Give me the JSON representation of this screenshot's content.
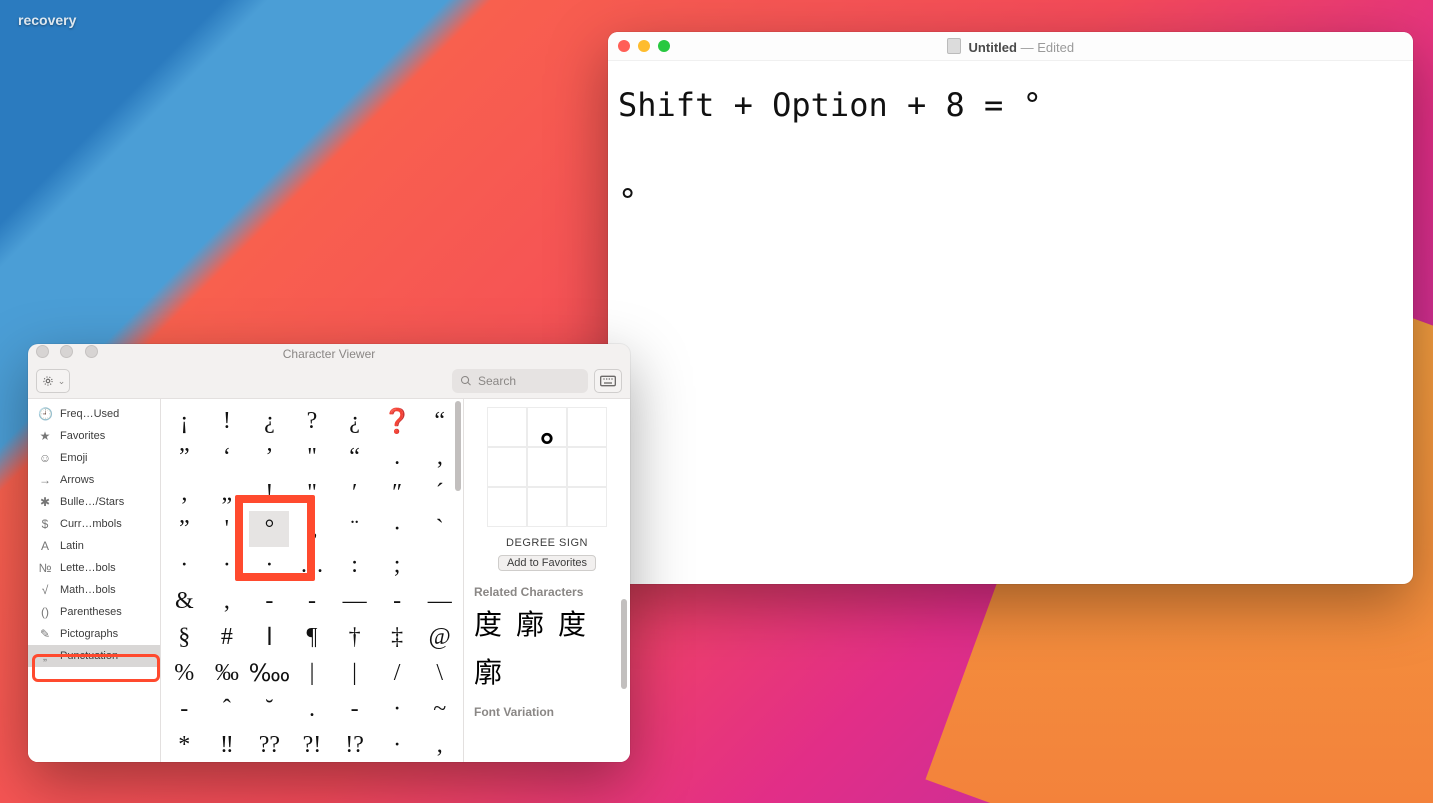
{
  "desktop": {
    "folder_name": "recovery"
  },
  "textedit": {
    "title": "Untitled",
    "status": "Edited",
    "content": "Shift + Option + 8 = °\n\n°"
  },
  "char_viewer": {
    "title": "Character Viewer",
    "search_placeholder": "Search",
    "categories": [
      {
        "icon": "🕘",
        "label": "Freq…Used"
      },
      {
        "icon": "★",
        "label": "Favorites"
      },
      {
        "icon": "☺",
        "label": "Emoji"
      },
      {
        "icon": "→",
        "label": "Arrows"
      },
      {
        "icon": "✱",
        "label": "Bulle…/Stars"
      },
      {
        "icon": "$",
        "label": "Curr…mbols"
      },
      {
        "icon": "A",
        "label": "Latin"
      },
      {
        "icon": "№",
        "label": "Lette…bols"
      },
      {
        "icon": "√",
        "label": "Math…bols"
      },
      {
        "icon": "()",
        "label": "Parentheses"
      },
      {
        "icon": "✎",
        "label": "Pictographs"
      },
      {
        "icon": "„",
        "label": "Punctuation",
        "selected": true
      }
    ],
    "glyph_rows": [
      [
        "¡",
        "!",
        "¿",
        "?",
        "¿",
        "❓",
        "“"
      ],
      [
        "”",
        "‘",
        "’",
        "\"",
        "“",
        " .",
        "‚"
      ],
      [
        "‚",
        "„",
        "!",
        "\"",
        "′",
        "″",
        "´"
      ],
      [
        "”",
        "'",
        "°",
        "„",
        "¨",
        "·",
        "`"
      ],
      [
        "·",
        "·",
        "·",
        "…",
        ":",
        ";",
        " "
      ],
      [
        "&",
        ",",
        "-",
        "-",
        "—",
        "-",
        "—"
      ],
      [
        "§",
        "#",
        "ا",
        "¶",
        "†",
        "‡",
        "@"
      ],
      [
        "%",
        "‰",
        "‱",
        "|",
        "|",
        "/",
        "\\"
      ],
      [
        "-",
        "ˆ",
        "˘",
        ".",
        "-",
        "·",
        "~"
      ],
      [
        "*",
        "‼",
        "??",
        "?!",
        "!?",
        "·",
        ","
      ]
    ],
    "selected_glyph_index": {
      "row": 3,
      "col": 2
    },
    "detail": {
      "preview_char": "°",
      "name": "DEGREE SIGN",
      "fav_button": "Add to Favorites",
      "related_label": "Related Characters",
      "related": [
        "度",
        "廓",
        "度",
        "廓"
      ],
      "font_var_label": "Font Variation"
    }
  }
}
